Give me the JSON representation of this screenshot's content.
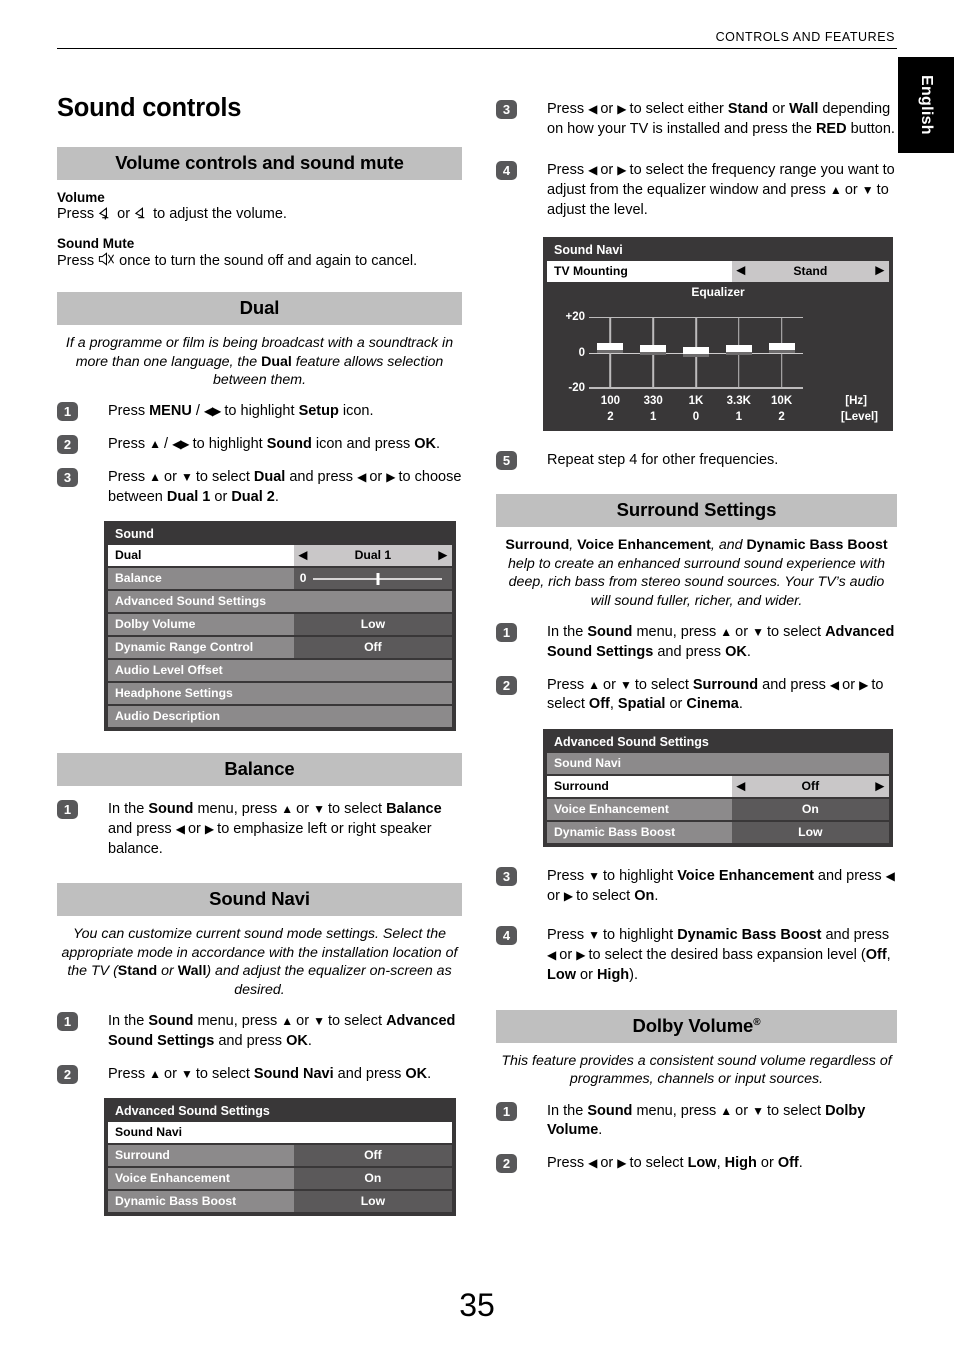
{
  "header": {
    "running_head": "CONTROLS AND FEATURES",
    "language_tab": "English"
  },
  "page_number": "35",
  "left_column": {
    "main_title": "Sound controls",
    "volume_section": {
      "band_title": "Volume controls and sound mute",
      "volume_head": "Volume",
      "volume_text_pre": "Press",
      "volume_icon_up": "volume-up-icon",
      "volume_text_or": "or",
      "volume_icon_down": "volume-down-icon",
      "volume_text_post": "to adjust the volume.",
      "mute_head": "Sound Mute",
      "mute_text_pre": "Press",
      "mute_icon": "mute-icon",
      "mute_text_post": "once to turn the sound off and again to cancel."
    },
    "dual_section": {
      "band_title": "Dual",
      "intro_1": "If a programme or film is being broadcast with a soundtrack in more than one language, the ",
      "intro_bold": "Dual",
      "intro_2": " feature allows selection between them.",
      "steps": [
        {
          "num": "1",
          "html": "Press <b>MENU</b> / <span class=\"ar\">◀▶</span> to highlight <b>Setup</b> icon."
        },
        {
          "num": "2",
          "html": "Press <span class=\"ar\">▲</span> / <span class=\"ar\">◀▶</span> to highlight <b>Sound</b> icon and press <b>OK</b>."
        },
        {
          "num": "3",
          "html": "Press <span class=\"ar\">▲</span> or <span class=\"ar\">▼</span> to select <b>Dual</b> and press <span class=\"ar\">◀</span> or <span class=\"ar\">▶</span> to choose between <b>Dual 1</b> or <b>Dual 2</b>."
        }
      ]
    },
    "sound_menu": {
      "title": "Sound",
      "rows": [
        {
          "label": "Dual",
          "value": "Dual 1",
          "state": "selected",
          "arrows": true
        },
        {
          "label": "Balance",
          "value": "0",
          "state": "slider"
        },
        {
          "label": "Advanced Sound Settings",
          "value": "",
          "state": "full"
        },
        {
          "label": "Dolby Volume",
          "value": "Low",
          "state": "normal"
        },
        {
          "label": "Dynamic Range Control",
          "value": "Off",
          "state": "normal"
        },
        {
          "label": "Audio Level Offset",
          "value": "",
          "state": "full"
        },
        {
          "label": "Headphone Settings",
          "value": "",
          "state": "full"
        },
        {
          "label": "Audio Description",
          "value": "",
          "state": "full"
        }
      ]
    },
    "balance_section": {
      "band_title": "Balance",
      "steps": [
        {
          "num": "1",
          "html": "In the <b>Sound</b> menu, press <span class=\"ar\">▲</span> or <span class=\"ar\">▼</span> to select <b>Balance</b> and press <span class=\"ar\">◀</span> or <span class=\"ar\">▶</span> to emphasize left or right speaker balance."
        }
      ]
    },
    "sound_navi_section": {
      "band_title": "Sound Navi",
      "intro_html": "You can customize current sound mode settings. Select the appropriate mode in accordance with the installation location of the TV (<b>Stand</b> <i>or</i> <b>Wall</b>) and adjust the equalizer on-screen as desired.",
      "steps": [
        {
          "num": "1",
          "html": "In the <b>Sound</b> menu, press <span class=\"ar\">▲</span> or <span class=\"ar\">▼</span> to select <b>Advanced Sound Settings</b> and press <b>OK</b>."
        },
        {
          "num": "2",
          "html": "Press <span class=\"ar\">▲</span> or <span class=\"ar\">▼</span> to select <b>Sound Navi</b> and press <b>OK</b>."
        }
      ]
    },
    "advanced_menu": {
      "title": "Advanced Sound Settings",
      "rows": [
        {
          "label": "Sound Navi",
          "value": "",
          "state": "sel-white-full"
        },
        {
          "label": "Surround",
          "value": "Off",
          "state": "normal"
        },
        {
          "label": "Voice Enhancement",
          "value": "On",
          "state": "normal"
        },
        {
          "label": "Dynamic Bass Boost",
          "value": "Low",
          "state": "normal"
        }
      ]
    }
  },
  "right_column": {
    "top_steps": [
      {
        "num": "3",
        "html": "Press <span class=\"ar\">◀</span> or <span class=\"ar\">▶</span> to select either <b>Stand</b> or <b>Wall</b> depending on how your TV is installed and press the <b>RED</b> button."
      },
      {
        "num": "4",
        "html": "Press <span class=\"ar\">◀</span> or <span class=\"ar\">▶</span> to select the frequency range you want to adjust from the equalizer window and press <span class=\"ar\">▲</span> or <span class=\"ar\">▼</span> to adjust the level."
      }
    ],
    "equalizer_osd": {
      "title": "Sound Navi",
      "row_label": "TV Mounting",
      "row_value": "Stand",
      "caption": "Equalizer",
      "y_top": "+20",
      "y_mid": "0",
      "y_bottom": "-20",
      "unit_hz": "[Hz]",
      "unit_level": "[Level]"
    },
    "step_5": {
      "num": "5",
      "html": "Repeat step 4 for other frequencies."
    },
    "surround_section": {
      "band_title": "Surround Settings",
      "intro_html": "<b>Surround</b>, <b>Voice Enhancement</b>, <i>and</i> <b>Dynamic Bass Boost</b> help to create an enhanced surround sound experience with deep, rich bass from stereo sound sources. Your TV’s audio will sound fuller, richer, and wider.",
      "steps": [
        {
          "num": "1",
          "html": "In the <b>Sound</b> menu, press <span class=\"ar\">▲</span> or <span class=\"ar\">▼</span> to select <b>Advanced Sound Settings</b> and press <b>OK</b>."
        },
        {
          "num": "2",
          "html": "Press <span class=\"ar\">▲</span> or <span class=\"ar\">▼</span> to select <b>Surround</b> and press <span class=\"ar\">◀</span> or <span class=\"ar\">▶</span> to select <b>Off</b>, <b>Spatial</b> or <b>Cinema</b>."
        }
      ]
    },
    "advanced_menu": {
      "title": "Advanced Sound Settings",
      "rows": [
        {
          "label": "Sound Navi",
          "value": "",
          "state": "full"
        },
        {
          "label": "Surround",
          "value": "Off",
          "state": "selected",
          "arrows": true
        },
        {
          "label": "Voice Enhancement",
          "value": "On",
          "state": "normal"
        },
        {
          "label": "Dynamic Bass Boost",
          "value": "Low",
          "state": "normal"
        }
      ]
    },
    "bottom_steps": [
      {
        "num": "3",
        "html": "Press <span class=\"ar\">▼</span> to highlight <b>Voice Enhancement</b> and press <span class=\"ar\">◀</span> or <span class=\"ar\">▶</span> to select <b>On</b>."
      },
      {
        "num": "4",
        "html": "Press <span class=\"ar\">▼</span> to highlight <b>Dynamic Bass Boost</b> and press <span class=\"ar\">◀</span> or <span class=\"ar\">▶</span> to select the desired bass expansion level (<b>Off</b>, <b>Low</b> or <b>High</b>)."
      }
    ],
    "dolby_section": {
      "band_title": "Dolby Volume",
      "band_sup": "®",
      "intro_html": "This feature provides a consistent sound volume regardless of programmes, channels or input sources.",
      "steps": [
        {
          "num": "1",
          "html": "In the <b>Sound</b> menu, press <span class=\"ar\">▲</span> or <span class=\"ar\">▼</span> to select <b>Dolby Volume</b>."
        },
        {
          "num": "2",
          "html": "Press <span class=\"ar\">◀</span> or <span class=\"ar\">▶</span> to select <b>Low</b>, <b>High</b> or <b>Off</b>."
        }
      ]
    }
  },
  "chart_data": {
    "type": "bar",
    "title": "Equalizer",
    "categories": [
      "100",
      "330",
      "1K",
      "3.3K",
      "10K"
    ],
    "values": [
      2,
      1,
      0,
      1,
      2
    ],
    "xlabel": "[Hz]",
    "ylabel": "[Level]",
    "ylim": [
      -20,
      20
    ],
    "ytick_labels": [
      "+20",
      "0",
      "-20"
    ],
    "level_labels": [
      "2",
      "1",
      "0",
      "1",
      "2"
    ],
    "grid": true,
    "legend": "none"
  },
  "colors": {
    "band_grey": "#bfbfbf",
    "osd_bg": "#393738",
    "osd_label": "#8c8a8b",
    "osd_value": "#5b595a",
    "badge": "#58585a",
    "selected": "#ffffff",
    "selected_value": "#c9c7c8"
  }
}
